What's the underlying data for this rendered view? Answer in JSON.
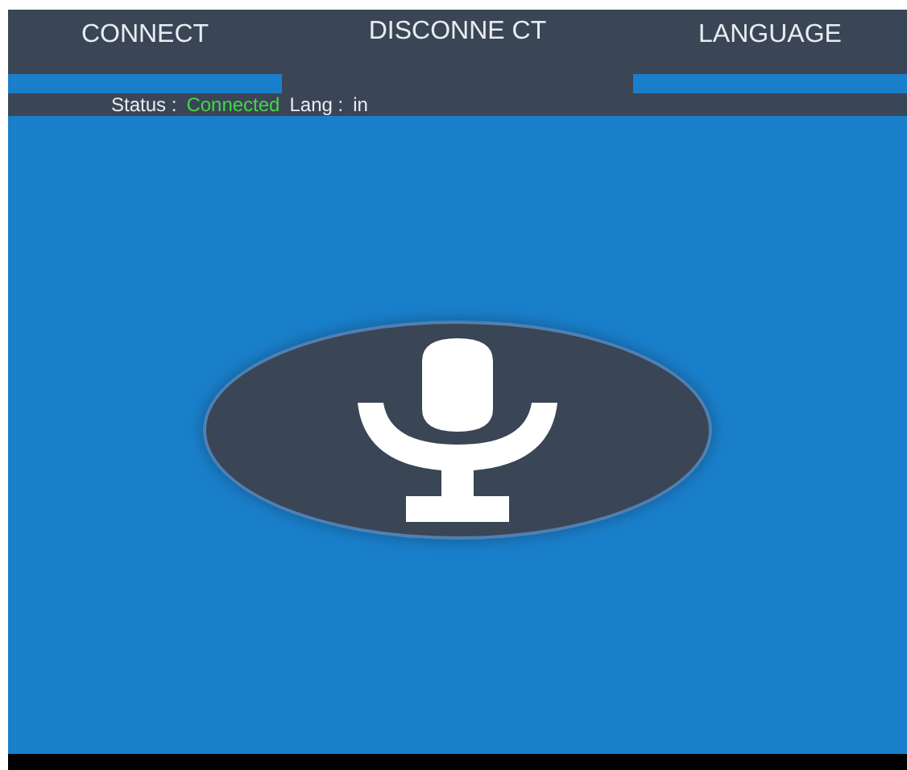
{
  "tabs": [
    {
      "label": "CONNECT",
      "selected": false
    },
    {
      "label": "DISCONNE CT",
      "selected": true
    },
    {
      "label": "LANGUAGE",
      "selected": false
    }
  ],
  "status": {
    "label": "Status :",
    "value": "Connected",
    "lang_label": "Lang :",
    "lang_value": "in"
  }
}
